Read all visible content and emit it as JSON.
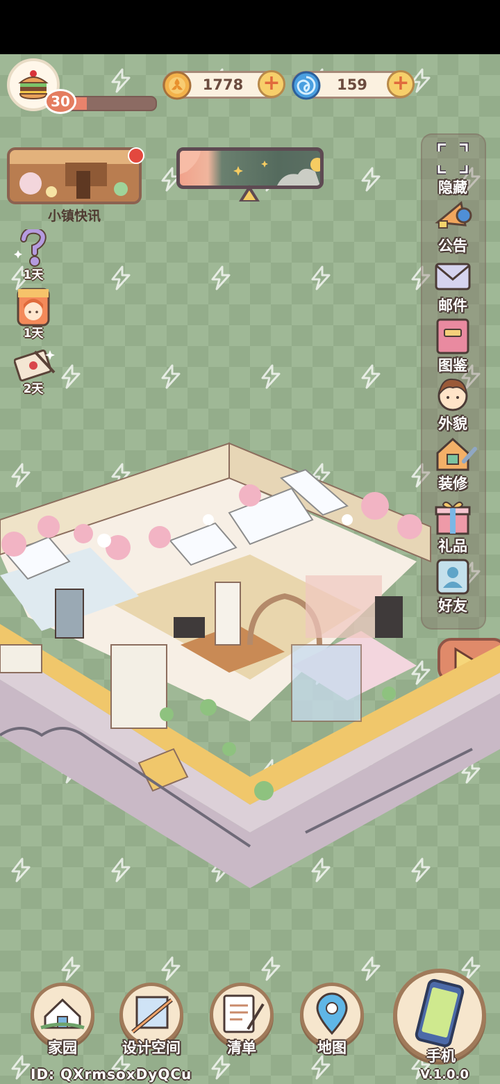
{
  "player": {
    "level": "30",
    "xp_progress": 0.25,
    "id_label": "ID:",
    "id_value": "QXrmsoxDyQCu"
  },
  "currencies": [
    {
      "name": "coin",
      "icon": "coin-icon",
      "value": "1778"
    },
    {
      "name": "gem",
      "icon": "swirl-gem-icon",
      "value": "159"
    }
  ],
  "news": {
    "label": "小镇快讯"
  },
  "events": [
    {
      "icon": "mystery-question-icon",
      "days": "1天"
    },
    {
      "icon": "character-card-icon",
      "days": "1天"
    },
    {
      "icon": "love-letter-icon",
      "days": "2天"
    }
  ],
  "side_menu": [
    {
      "key": "hide",
      "label": "隐藏",
      "icon": "hide-frame-icon"
    },
    {
      "key": "notice",
      "label": "公告",
      "icon": "megaphone-icon"
    },
    {
      "key": "mail",
      "label": "邮件",
      "icon": "envelope-icon"
    },
    {
      "key": "catalog",
      "label": "图鉴",
      "icon": "book-icon"
    },
    {
      "key": "appearance",
      "label": "外貌",
      "icon": "character-face-icon"
    },
    {
      "key": "decorate",
      "label": "装修",
      "icon": "house-wrench-icon"
    },
    {
      "key": "gift",
      "label": "礼品",
      "icon": "gift-box-icon"
    },
    {
      "key": "friends",
      "label": "好友",
      "icon": "friend-card-icon"
    }
  ],
  "bottom_nav": [
    {
      "key": "home",
      "label": "家园",
      "icon": "home-icon"
    },
    {
      "key": "design",
      "label": "设计空间",
      "icon": "design-ruler-icon"
    },
    {
      "key": "list",
      "label": "清单",
      "icon": "list-quill-icon"
    },
    {
      "key": "map",
      "label": "地图",
      "icon": "map-pin-icon"
    }
  ],
  "phone": {
    "label": "手机",
    "version": "V.1.0.0",
    "icon": "phone-icon"
  },
  "colors": {
    "background": "#9fb896",
    "checker": "#94ad8b",
    "panel_border": "#a07a5a",
    "accent_orange": "#e08a6a"
  }
}
